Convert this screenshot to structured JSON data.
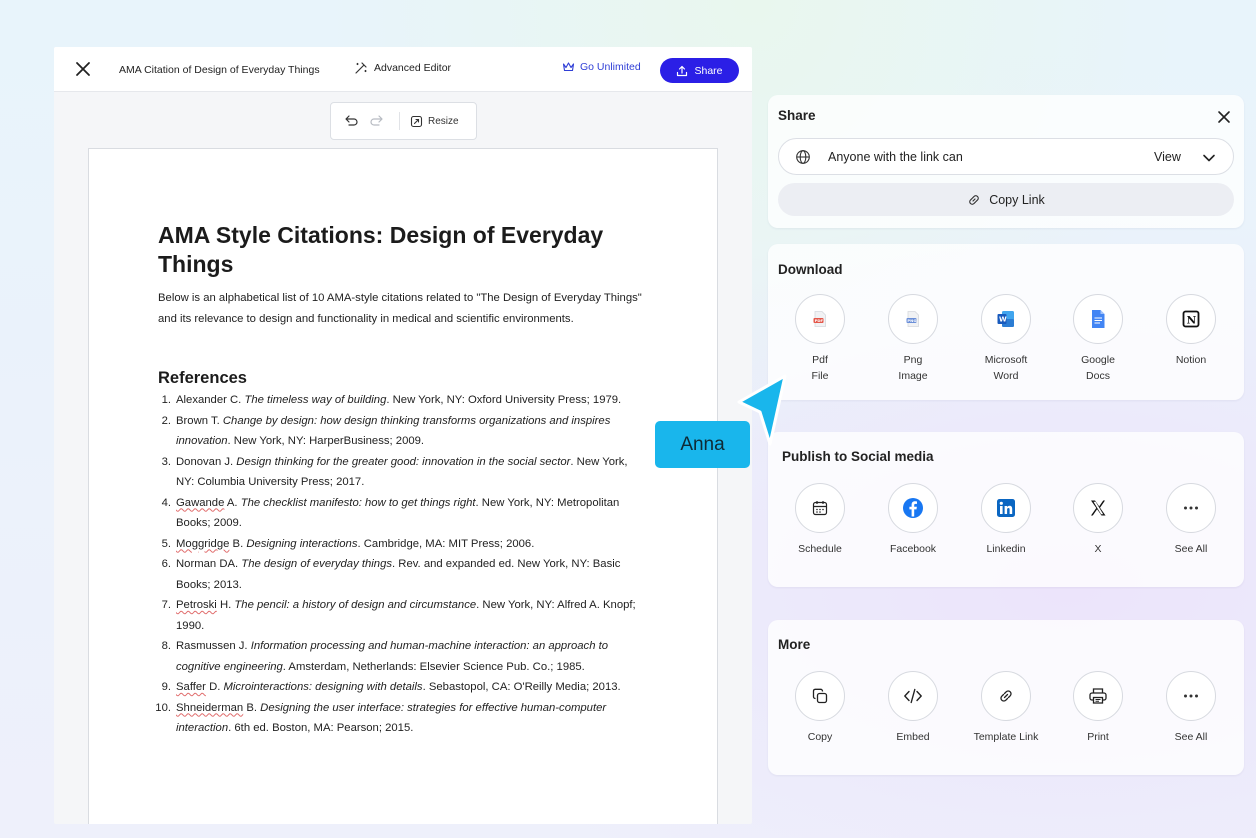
{
  "editor": {
    "doc_title": "AMA Citation of Design of Everyday Things",
    "advanced_editor": "Advanced Editor",
    "go_unlimited": "Go Unlimited",
    "share": "Share",
    "resize": "Resize"
  },
  "document": {
    "title": "AMA Style Citations: Design of Everyday Things",
    "intro": "Below is an alphabetical list of 10 AMA-style citations related to \"The Design of Everyday Things\" and its relevance to design and functionality in medical and scientific environments.",
    "references_heading": "References",
    "references": [
      {
        "n": "1.",
        "a": "Alexander C. ",
        "sq": "",
        "b": "",
        "t": "The timeless way of building",
        "c": ". New York, NY: Oxford University Press; 1979."
      },
      {
        "n": "2.",
        "a": "Brown T. ",
        "sq": "",
        "b": "",
        "t": "Change by design: how design thinking transforms organizations and inspires innovation",
        "c": ". New York, NY: HarperBusiness; 2009."
      },
      {
        "n": "3.",
        "a": "Donovan J. ",
        "sq": "",
        "b": "",
        "t": "Design thinking for the greater good: innovation in the social sector",
        "c": ". New York, NY: Columbia University Press; 2017."
      },
      {
        "n": "4.",
        "a": "",
        "sq": "Gawande",
        "b": " A. ",
        "t": "The checklist manifesto: how to get things right",
        "c": ". New York, NY: Metropolitan Books; 2009."
      },
      {
        "n": "5.",
        "a": "",
        "sq": "Moggridge",
        "b": " B. ",
        "t": "Designing interactions",
        "c": ". Cambridge, MA: MIT Press; 2006."
      },
      {
        "n": "6.",
        "a": "Norman DA. ",
        "sq": "",
        "b": "",
        "t": "The design of everyday things",
        "c": ". Rev. and expanded ed. New York, NY: Basic Books; 2013."
      },
      {
        "n": "7.",
        "a": "",
        "sq": "Petroski",
        "b": " H. ",
        "t": "The pencil: a history of design and circumstance",
        "c": ". New York, NY: Alfred A. Knopf; 1990."
      },
      {
        "n": "8.",
        "a": "Rasmussen J. ",
        "sq": "",
        "b": "",
        "t": "Information processing and human-machine interaction: an approach to cognitive engineering",
        "c": ". Amsterdam, Netherlands: Elsevier Science Pub. Co.; 1985."
      },
      {
        "n": "9.",
        "a": "",
        "sq": "Saffer",
        "b": " D. ",
        "t": "Microinteractions: designing with details",
        "c": ". Sebastopol, CA: O'Reilly Media; 2013."
      },
      {
        "n": "10.",
        "a": "",
        "sq": "Shneiderman",
        "b": " B. ",
        "t": "Designing the user interface: strategies for effective human-computer interaction",
        "c": ". 6th ed. Boston, MA: Pearson; 2015."
      }
    ]
  },
  "share_panel": {
    "title": "Share",
    "permission_text": "Anyone with the link can",
    "permission_value": "View",
    "copy_link": "Copy Link"
  },
  "download": {
    "title": "Download",
    "items": [
      {
        "label1": "Pdf",
        "label2": "File",
        "icon": "pdf-file-icon"
      },
      {
        "label1": "Png",
        "label2": "Image",
        "icon": "png-image-icon"
      },
      {
        "label1": "Microsoft",
        "label2": "Word",
        "icon": "word-icon"
      },
      {
        "label1": "Google",
        "label2": "Docs",
        "icon": "google-docs-icon"
      },
      {
        "label1": "Notion",
        "label2": "",
        "icon": "notion-icon"
      }
    ]
  },
  "social": {
    "title": "Publish to Social media",
    "items": [
      "Schedule",
      "Facebook",
      "Linkedin",
      "X",
      "See All"
    ]
  },
  "more": {
    "title": "More",
    "items": [
      "Copy",
      "Embed",
      "Template Link",
      "Print",
      "See All"
    ]
  },
  "collaborator": {
    "name": "Anna",
    "color": "#19b6ec"
  },
  "colors": {
    "accent": "#2b1fe6",
    "go_unlimited": "#2f3ed6"
  }
}
